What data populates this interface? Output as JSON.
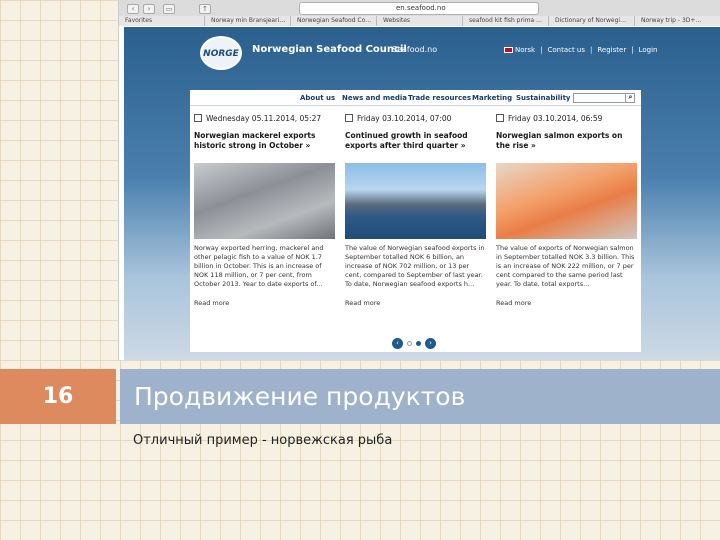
{
  "browser": {
    "url": "en.seafood.no",
    "tabs": [
      "Favorites",
      "Norway min Bransjeari…",
      "Norwegian Seafood Co…",
      "Websites",
      "seafood kit fish prima …",
      "Dictionary of Norwegi…",
      "Norway trip - 3D+..."
    ]
  },
  "site": {
    "logo_text": "NORGE",
    "brand": "Norwegian Seafood Council",
    "brand_domain": "Seafood.no",
    "top_links": [
      "Norsk",
      "Contact us",
      "Register",
      "Login"
    ],
    "nav": [
      "About us",
      "News and media",
      "Trade resources",
      "Marketing",
      "Sustainability"
    ],
    "articles": [
      {
        "date": "Wednesday 05.11.2014, 05:27",
        "headline": "Norwegian mackerel exports historic strong in October »",
        "body": "Norway exported herring, mackerel and other pelagic fish to a value of NOK 1.7 billion in October. This is an increase of NOK 118 million, or 7 per cent, from October 2013. Year to date exports of...",
        "more": "Read more"
      },
      {
        "date": "Friday 03.10.2014, 07:00",
        "headline": "Continued growth in seafood exports after third quarter »",
        "body": "The value of Norwegian seafood exports in September totalled NOK 6 billion, an increase of NOK 702 million, or 13 per cent, compared to September of last year. To date, Norwegian seafood exports h...",
        "more": "Read more"
      },
      {
        "date": "Friday 03.10.2014, 06:59",
        "headline": "Norwegian salmon exports on the rise »",
        "body": "The value of exports of Norwegian salmon in September totalled NOK 3.3 billion. This is an increase of NOK 222 million, or 7 per cent compared to the same period last year. To date, total exports...",
        "more": "Read more"
      }
    ]
  },
  "slide": {
    "number": "16",
    "title": "Продвижение продуктов",
    "subtitle": "Отличный пример - норвежская рыба"
  }
}
